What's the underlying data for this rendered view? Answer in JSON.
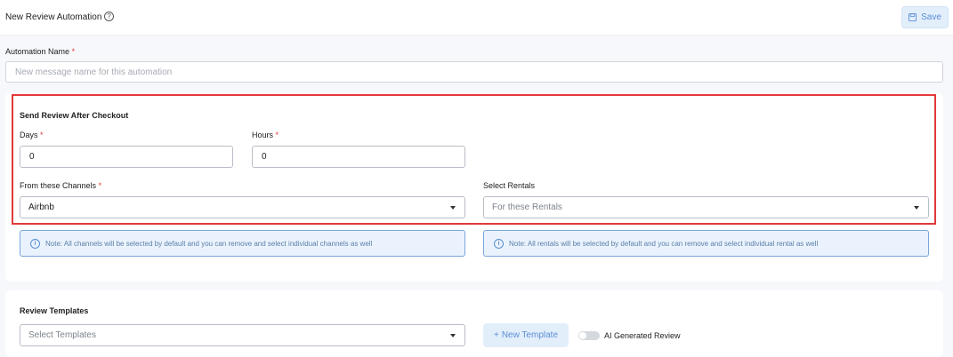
{
  "header": {
    "title": "New Review Automation",
    "help_icon": "help-circle-icon",
    "save_label": "Save",
    "save_icon": "floppy-disk-icon"
  },
  "automation_name": {
    "label": "Automation Name",
    "required_mark": "*",
    "placeholder": "New message name for this automation",
    "value": ""
  },
  "send_review": {
    "title": "Send Review After Checkout",
    "days": {
      "label": "Days",
      "required_mark": "*",
      "value": "0"
    },
    "hours": {
      "label": "Hours",
      "required_mark": "*",
      "value": "0"
    },
    "channels": {
      "label": "From these Channels",
      "required_mark": "*",
      "selected": "Airbnb"
    },
    "rentals": {
      "label": "Select Rentals",
      "placeholder": "For these Rentals"
    },
    "channels_note": "Note: All channels will be selected by default and you can remove and select individual channels as well",
    "rentals_note": "Note: All rentals will be selected by default and you can remove and select individual rental as well"
  },
  "review_templates": {
    "title": "Review Templates",
    "select_placeholder": "Select Templates",
    "new_template_label": "New Template",
    "new_template_prefix": "+",
    "ai_toggle_label": "AI Generated Review",
    "ai_toggle_on": false
  },
  "colors": {
    "accent": "#5b8fd6",
    "required": "#e03a3a",
    "highlight_border": "#e2393a",
    "note_bg": "#eaf3fd"
  }
}
